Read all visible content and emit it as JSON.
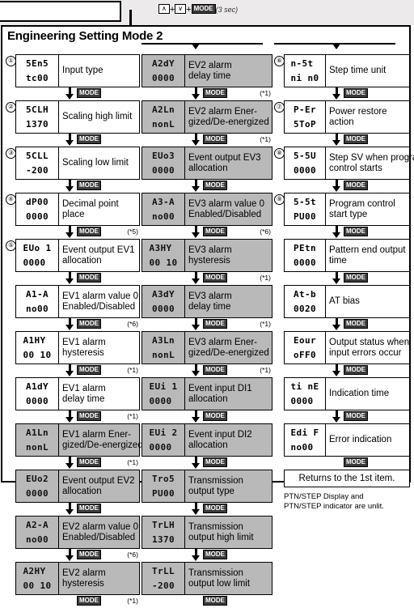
{
  "top": {
    "key1": "∧",
    "key2": "∨",
    "key3": "MODE",
    "plus": "+",
    "duration": "(3 sec)"
  },
  "title": "Engineering Setting Mode 2",
  "mode_label": "MODE",
  "columns": [
    {
      "id": "column-1",
      "shaded_from": 8,
      "items": [
        {
          "index": "①",
          "lcd_top": "5En5",
          "lcd_bottom": "tc00",
          "lines": [
            "Input type"
          ],
          "note": ""
        },
        {
          "index": "②",
          "lcd_top": "5CLH",
          "lcd_bottom": "1370",
          "lines": [
            "Scaling high limit"
          ],
          "note": ""
        },
        {
          "index": "③",
          "lcd_top": "5CLL",
          "lcd_bottom": "-200",
          "lines": [
            "Scaling low limit"
          ],
          "note": ""
        },
        {
          "index": "④",
          "lcd_top": "dP00",
          "lcd_bottom": "0000",
          "lines": [
            "Decimal point",
            "place"
          ],
          "note": "(*5)"
        },
        {
          "index": "⑤",
          "lcd_top": "EUo 1",
          "lcd_bottom": "0000",
          "lines": [
            "Event output EV1",
            "allocation"
          ],
          "note": ""
        },
        {
          "index": "",
          "lcd_top": "A1-A",
          "lcd_bottom": "no00",
          "lines": [
            "EV1 alarm value 0",
            "Enabled/Disabled"
          ],
          "note": "(*6)"
        },
        {
          "index": "",
          "lcd_top": "A1HY",
          "lcd_bottom": "00 10",
          "lines": [
            "EV1 alarm",
            "hysteresis"
          ],
          "note": "(*1)"
        },
        {
          "index": "",
          "lcd_top": "A1dY",
          "lcd_bottom": "0000",
          "lines": [
            "EV1 alarm",
            "delay time"
          ],
          "note": "(*1)"
        },
        {
          "index": "",
          "lcd_top": "A1Ln",
          "lcd_bottom": "nonL",
          "lines": [
            "EV1 alarm Ener-",
            "gized/De-energized"
          ],
          "note": "(*1)"
        },
        {
          "index": "",
          "lcd_top": "EUo2",
          "lcd_bottom": "0000",
          "lines": [
            "Event output EV2",
            "allocation"
          ],
          "note": ""
        },
        {
          "index": "",
          "lcd_top": "A2-A",
          "lcd_bottom": "no00",
          "lines": [
            "EV2 alarm value 0",
            "Enabled/Disabled"
          ],
          "note": "(*6)"
        },
        {
          "index": "",
          "lcd_top": "A2HY",
          "lcd_bottom": "00 10",
          "lines": [
            "EV2 alarm",
            "hysteresis"
          ],
          "note": "(*1)"
        }
      ]
    },
    {
      "id": "column-2",
      "shaded_from": 0,
      "items": [
        {
          "index": "",
          "lcd_top": "A2dY",
          "lcd_bottom": "0000",
          "lines": [
            "EV2 alarm",
            "delay time"
          ],
          "note": "(*1)"
        },
        {
          "index": "",
          "lcd_top": "A2Ln",
          "lcd_bottom": "nonL",
          "lines": [
            "EV2 alarm Ener-",
            "gized/De-energized"
          ],
          "note": "(*1)"
        },
        {
          "index": "",
          "lcd_top": "EUo3",
          "lcd_bottom": "0000",
          "lines": [
            "Event output EV3",
            "allocation"
          ],
          "note": ""
        },
        {
          "index": "",
          "lcd_top": "A3-A",
          "lcd_bottom": "no00",
          "lines": [
            "EV3 alarm value 0",
            "Enabled/Disabled"
          ],
          "note": "(*6)"
        },
        {
          "index": "",
          "lcd_top": "A3HY",
          "lcd_bottom": "00 10",
          "lines": [
            "EV3 alarm",
            "hysteresis"
          ],
          "note": "(*1)"
        },
        {
          "index": "",
          "lcd_top": "A3dY",
          "lcd_bottom": "0000",
          "lines": [
            "EV3 alarm",
            "delay time"
          ],
          "note": "(*1)"
        },
        {
          "index": "",
          "lcd_top": "A3Ln",
          "lcd_bottom": "nonL",
          "lines": [
            "EV3 alarm Ener-",
            "gized/De-energized"
          ],
          "note": "(*1)"
        },
        {
          "index": "",
          "lcd_top": "EUi 1",
          "lcd_bottom": "0000",
          "lines": [
            "Event input DI1",
            "allocation"
          ],
          "note": ""
        },
        {
          "index": "",
          "lcd_top": "EUi 2",
          "lcd_bottom": "0000",
          "lines": [
            "Event input DI2",
            "allocation"
          ],
          "note": ""
        },
        {
          "index": "",
          "lcd_top": "Tro5",
          "lcd_bottom": "PU00",
          "lines": [
            "Transmission",
            "output type"
          ],
          "note": ""
        },
        {
          "index": "",
          "lcd_top": "TrLH",
          "lcd_bottom": "1370",
          "lines": [
            "Transmission",
            "output high limit"
          ],
          "note": ""
        },
        {
          "index": "",
          "lcd_top": "TrLL",
          "lcd_bottom": "-200",
          "lines": [
            "Transmission",
            "output low limit"
          ],
          "note": ""
        }
      ]
    },
    {
      "id": "column-3",
      "shaded_from": -1,
      "items": [
        {
          "index": "⑥",
          "lcd_top": "n-5t",
          "lcd_bottom": "ni n0",
          "lines": [
            "Step time unit"
          ],
          "note": ""
        },
        {
          "index": "⑦",
          "lcd_top": "P-Er",
          "lcd_bottom": "5ToP",
          "lines": [
            "Power restore",
            "action"
          ],
          "note": ""
        },
        {
          "index": "⑧",
          "lcd_top": "5-5U",
          "lcd_bottom": "0000",
          "lines": [
            "Step SV when program",
            "control starts"
          ],
          "note": ""
        },
        {
          "index": "⑨",
          "lcd_top": "5-5t",
          "lcd_bottom": "PU00",
          "lines": [
            "Program control",
            "start type"
          ],
          "note": ""
        },
        {
          "index": "",
          "lcd_top": "PEtn",
          "lcd_bottom": "0000",
          "lines": [
            "Pattern end output",
            "time"
          ],
          "note": ""
        },
        {
          "index": "",
          "lcd_top": "At-b",
          "lcd_bottom": "0020",
          "lines": [
            "AT bias"
          ],
          "note": ""
        },
        {
          "index": "",
          "lcd_top": "Eour",
          "lcd_bottom": "oFF0",
          "lines": [
            "Output status when",
            "input errors occur"
          ],
          "note": ""
        },
        {
          "index": "",
          "lcd_top": "ti nE",
          "lcd_bottom": "0000",
          "lines": [
            "Indication time"
          ],
          "note": ""
        },
        {
          "index": "",
          "lcd_top": "Edi F",
          "lcd_bottom": "no00",
          "lines": [
            "Error indication"
          ],
          "note": ""
        }
      ]
    }
  ],
  "returns_text": "Returns to the 1st item.",
  "footnote": [
    "PTN/STEP Display and",
    "PTN/STEP indicator are unlit."
  ]
}
